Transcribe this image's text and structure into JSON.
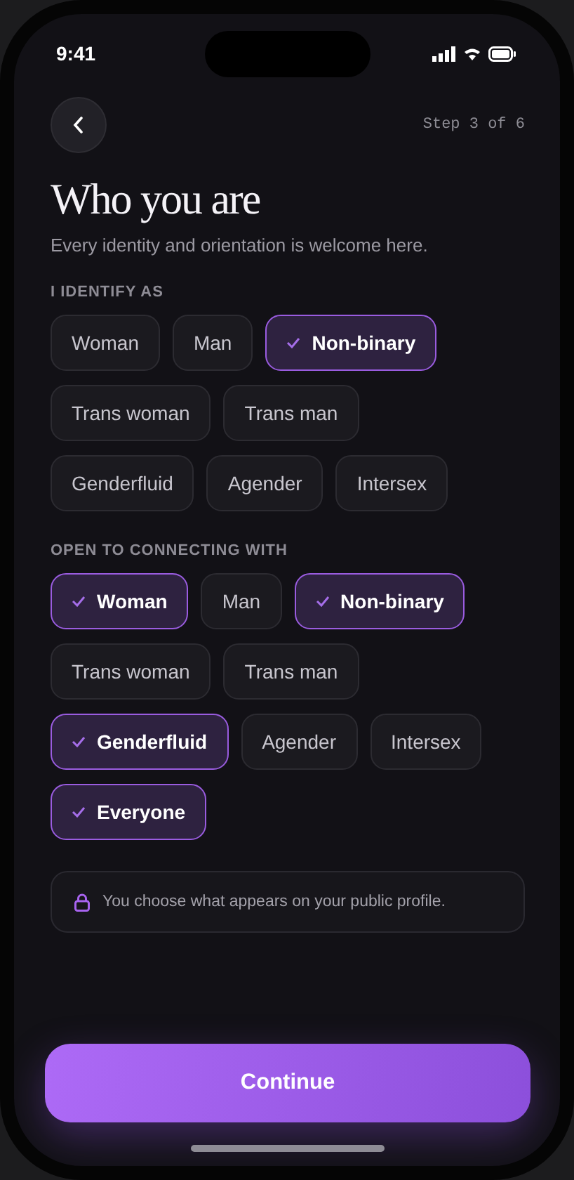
{
  "status_bar": {
    "time": "9:41"
  },
  "header": {
    "step": "Step 3 of 6"
  },
  "title": "Who you are",
  "subtitle": "Every identity and orientation is welcome here.",
  "sections": [
    {
      "label": "I IDENTIFY AS",
      "rows": [
        [
          {
            "label": "Woman",
            "selected": false
          },
          {
            "label": "Man",
            "selected": false
          },
          {
            "label": "Non-binary",
            "selected": true
          }
        ],
        [
          {
            "label": "Trans woman",
            "selected": false
          },
          {
            "label": "Trans man",
            "selected": false
          }
        ],
        [
          {
            "label": "Genderfluid",
            "selected": false
          },
          {
            "label": "Agender",
            "selected": false
          },
          {
            "label": "Intersex",
            "selected": false
          }
        ]
      ]
    },
    {
      "label": "OPEN TO CONNECTING WITH",
      "rows": [
        [
          {
            "label": "Woman",
            "selected": true
          },
          {
            "label": "Man",
            "selected": false
          },
          {
            "label": "Non-binary",
            "selected": true
          }
        ],
        [
          {
            "label": "Trans woman",
            "selected": false
          },
          {
            "label": "Trans man",
            "selected": false
          }
        ],
        [
          {
            "label": "Genderfluid",
            "selected": true
          },
          {
            "label": "Agender",
            "selected": false
          },
          {
            "label": "Intersex",
            "selected": false
          }
        ],
        [
          {
            "label": "Everyone",
            "selected": true
          }
        ]
      ]
    }
  ],
  "privacy_note": "You choose what appears on your public profile.",
  "primary_button": "Continue"
}
